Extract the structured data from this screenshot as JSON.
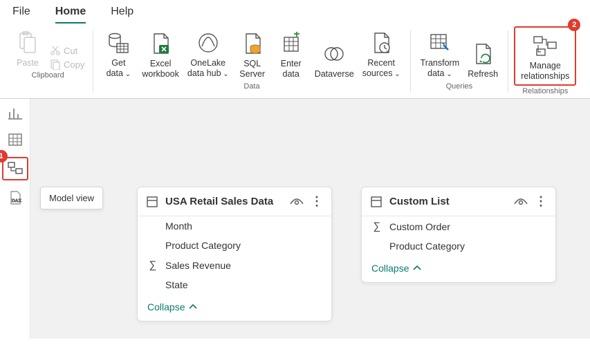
{
  "tabs": {
    "file": "File",
    "home": "Home",
    "help": "Help"
  },
  "ribbon": {
    "clipboard": {
      "paste": "Paste",
      "cut": "Cut",
      "copy": "Copy",
      "group": "Clipboard"
    },
    "data": {
      "get_data": "Get\ndata",
      "excel": "Excel\nworkbook",
      "onelake": "OneLake\ndata hub",
      "sql": "SQL\nServer",
      "enter": "Enter\ndata",
      "dataverse": "Dataverse",
      "recent": "Recent\nsources",
      "group": "Data"
    },
    "queries": {
      "transform": "Transform\ndata",
      "refresh": "Refresh",
      "group": "Queries"
    },
    "relationships": {
      "manage": "Manage\nrelationships",
      "group": "Relationships"
    }
  },
  "tooltip": "Model view",
  "annotations": {
    "badge1": "1",
    "badge2": "2"
  },
  "card1": {
    "title": "USA Retail Sales Data",
    "fields": [
      "Month",
      "Product Category",
      "Sales Revenue",
      "State"
    ],
    "sigma_index": 2,
    "collapse": "Collapse"
  },
  "card2": {
    "title": "Custom List",
    "fields": [
      "Custom Order",
      "Product Category"
    ],
    "sigma_index": 0,
    "collapse": "Collapse"
  }
}
